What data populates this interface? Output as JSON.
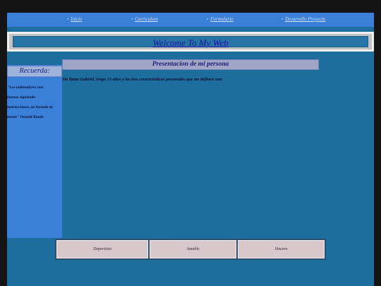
{
  "nav": {
    "items": [
      {
        "label": "Inicio"
      },
      {
        "label": "Curriculum"
      },
      {
        "label": "Formulario"
      },
      {
        "label": "Desarrollo Proyecto"
      }
    ]
  },
  "banner": {
    "title": "Welcome To My Web"
  },
  "sidebar": {
    "heading": "Recuerda:",
    "quote_lines": [
      "\"Los ordenadores son",
      "buenos siguiendo",
      "instrucciones, no leyendo tu",
      "mente\" Donald Knuth"
    ]
  },
  "main": {
    "heading": "Presentacion de mi persona",
    "intro": "Me llamo Gabriel, tengo 19 años y las tres caracteristicas personales que me definen son:"
  },
  "traits": [
    {
      "label": "Deportista"
    },
    {
      "label": "Amable"
    },
    {
      "label": "Sincero"
    }
  ],
  "colors": {
    "page_bg": "#1d6e9e",
    "nav_bg": "#3a7fd8",
    "trait_bg": "#d8c8cc"
  }
}
